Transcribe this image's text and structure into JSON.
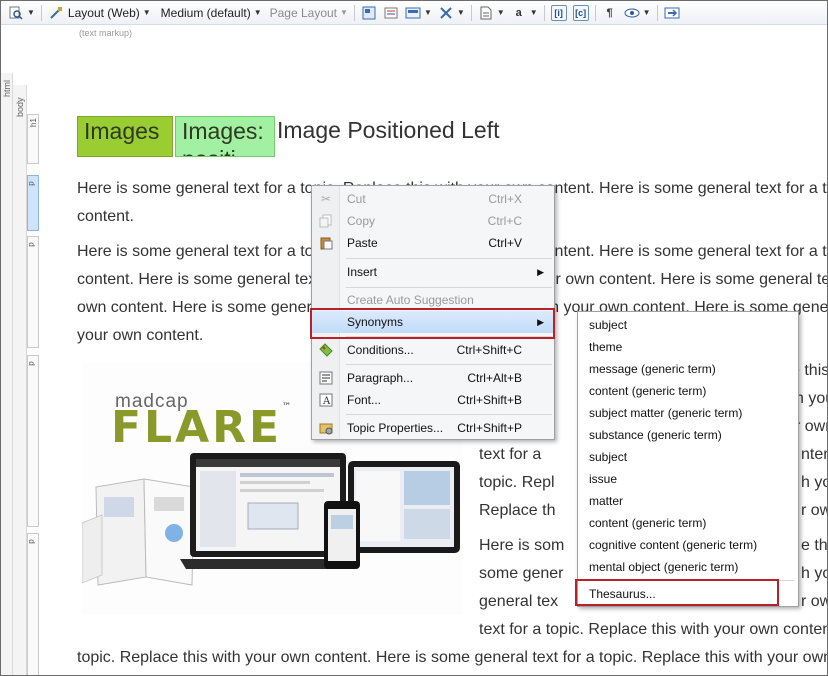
{
  "toolbar": {
    "layout": "Layout (Web)",
    "medium": "Medium (default)",
    "page_layout": "Page Layout",
    "text_markup": "(text markup)"
  },
  "structure": {
    "html": "html",
    "body": "body",
    "h1": "h1",
    "p": "p"
  },
  "heading": {
    "box1": "Images",
    "box2": "Images: positi",
    "text": "Image Positioned Left"
  },
  "paragraphs": {
    "p1_l1": "Here is some general text for a topic. Replace this with your own content. Here is some general text for a topic.",
    "p1_l2": "content.",
    "p2_l1": "Here is some general text for a topic. Replace this with your own content. Here is some general text for a topic.",
    "p2_l2": "content. Here is some general text for a topic. Replace this with your own content. Here is some general text for",
    "p2_l3": "own content. Here is some general text for a topic. Replace this with your own content. Here is some general",
    "p2_l4": "your own content.",
    "r1": "e this",
    "r2": "h you",
    "r3": "r own",
    "r4": "text for a",
    "r4b": "nten",
    "r5": "topic. Repl",
    "r5b": "h yo",
    "r6": "Replace th",
    "r6b": "r own",
    "r7": "Here is som",
    "r7b": "e this",
    "r8": "some gener",
    "r8b": "h yo",
    "r9": "general tex",
    "r9b": "r own",
    "r10": "text for a topic. Replace this with your own conten",
    "r11": "topic. Replace this with your own content. Here is some general text for a topic. Replace this with your own"
  },
  "image": {
    "madcap": "madcap",
    "flare": "FLARE",
    "tm": "™"
  },
  "context_menu": {
    "items": [
      {
        "label": "Cut",
        "shortcut": "Ctrl+X"
      },
      {
        "label": "Copy",
        "shortcut": "Ctrl+C"
      },
      {
        "label": "Paste",
        "shortcut": "Ctrl+V"
      },
      {
        "label": "Insert",
        "shortcut": ""
      },
      {
        "label": "Create Auto Suggestion",
        "shortcut": ""
      },
      {
        "label": "Synonyms",
        "shortcut": ""
      },
      {
        "label": "Conditions...",
        "shortcut": "Ctrl+Shift+C"
      },
      {
        "label": "Paragraph...",
        "shortcut": "Ctrl+Alt+B"
      },
      {
        "label": "Font...",
        "shortcut": "Ctrl+Shift+B"
      },
      {
        "label": "Topic Properties...",
        "shortcut": "Ctrl+Shift+P"
      }
    ]
  },
  "synonyms_menu": {
    "items": [
      "subject",
      "theme",
      "message (generic term)",
      "content (generic term)",
      "subject matter (generic term)",
      "substance (generic term)",
      "subject",
      "issue",
      "matter",
      "content (generic term)",
      "cognitive content (generic term)",
      "mental object (generic term)",
      "Thesaurus..."
    ]
  },
  "colors": {
    "highlight_red": "#b8202a",
    "heading_green": "#9acd32",
    "heading_light_green": "#a2f0a2"
  }
}
